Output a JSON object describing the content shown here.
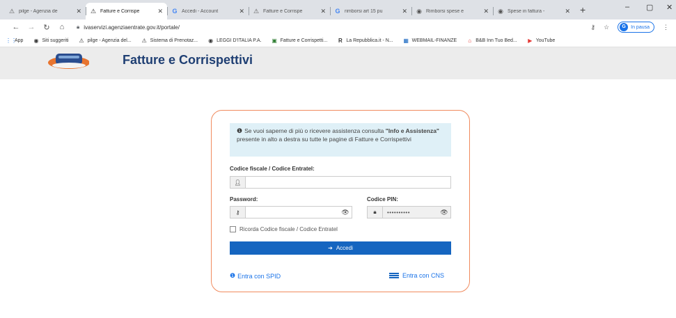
{
  "browser": {
    "tabs": [
      {
        "title": "pilge - Agenzia de",
        "icon": "agenzia-icon",
        "active": false
      },
      {
        "title": "Fatture e Corrispe",
        "icon": "agenzia-icon",
        "active": true
      },
      {
        "title": "Accedi - Account",
        "icon": "google-icon",
        "active": false
      },
      {
        "title": "Fatture e Corrispe",
        "icon": "agenzia-icon",
        "active": false
      },
      {
        "title": "rimborsi art 15 pu",
        "icon": "google-icon",
        "active": false
      },
      {
        "title": "Rimborsi spese e",
        "icon": "globe-icon",
        "active": false
      },
      {
        "title": "Spese in fattura -",
        "icon": "globe-icon",
        "active": false
      }
    ],
    "new_tab": "+",
    "window_controls": {
      "minimize": "–",
      "restore": "▢",
      "close": "✕"
    },
    "url": "ivaservizi.agenziaentrate.gov.it/portale/",
    "profile_label": "In pausa",
    "profile_initial": "G",
    "bookmarks": [
      {
        "label": "App",
        "icon": "apps-grid-icon"
      },
      {
        "label": "Siti suggeriti",
        "icon": "globe-icon"
      },
      {
        "label": "pilge - Agenzia del...",
        "icon": "agenzia-icon"
      },
      {
        "label": "Sistema di Prenotaz...",
        "icon": "agenzia-icon"
      },
      {
        "label": "LEGGI D'ITALIA P.A.",
        "icon": "globe-icon"
      },
      {
        "label": "Fatture e Corrispetti...",
        "icon": "invoice-icon"
      },
      {
        "label": "La Repubblica.it - N...",
        "icon": "repubblica-icon"
      },
      {
        "label": "WEBMAIL-FINANZE",
        "icon": "webmail-icon"
      },
      {
        "label": "B&B Inn Tuo Bed...",
        "icon": "bnb-icon"
      },
      {
        "label": "YouTube",
        "icon": "youtube-icon"
      }
    ]
  },
  "site": {
    "title": "Fatture e Corrispettivi"
  },
  "login": {
    "info_text_1": "Se vuoi saperne di più o ricevere assistenza consulta ",
    "info_bold": "\"Info e Assistenza\"",
    "info_text_2": " presente in alto a destra su tutte le pagine di Fatture e Corrispettivi",
    "cf_label": "Codice fiscale / Codice Entratel:",
    "cf_value": "",
    "password_label": "Password:",
    "password_value": "",
    "pin_label": "Codice PIN:",
    "pin_value": "••••••••••",
    "remember_label": "Ricorda Codice fiscale / Codice Entratel",
    "submit_label": "Accedi",
    "spid_label": "Entra con SPID",
    "cns_label": "Entra con CNS"
  },
  "colors": {
    "brand_blue": "#1f3f73",
    "button_blue": "#1565c0",
    "card_border": "#f08a5d",
    "info_bg": "#dff0f7"
  }
}
